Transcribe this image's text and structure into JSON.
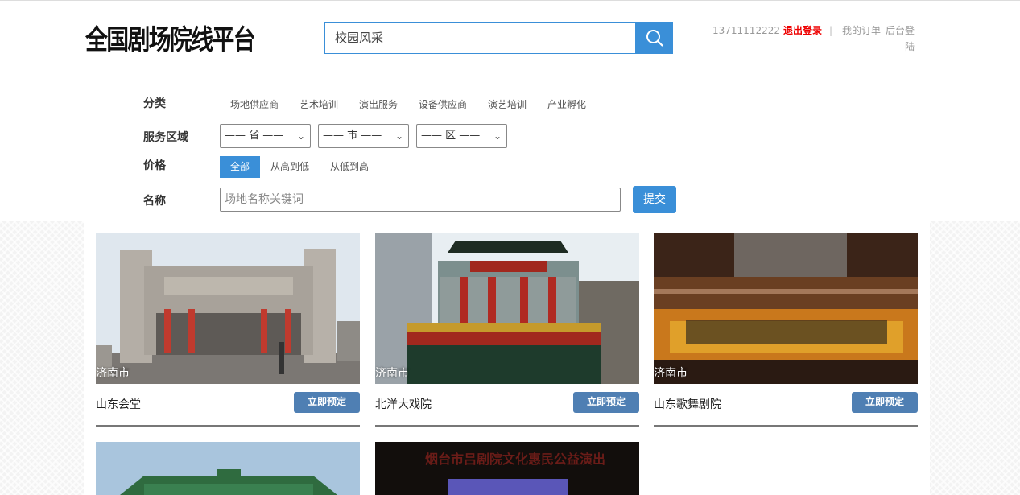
{
  "header": {
    "logo": "全国剧场院线平台",
    "search_value": "校园风采",
    "phone": "13711112222",
    "logout": "退出登录",
    "separator": "|",
    "my_orders": "我的订单",
    "admin_login": "后台登陆"
  },
  "filters": {
    "category_label": "分类",
    "categories": [
      "场地供应商",
      "艺术培训",
      "演出服务",
      "设备供应商",
      "演艺培训",
      "产业孵化"
    ],
    "region_label": "服务区域",
    "province": "—— 省 ——",
    "city": "—— 市 ——",
    "district": "—— 区 ——",
    "price_label": "价格",
    "price_options": [
      "全部",
      "从高到低",
      "从低到高"
    ],
    "name_label": "名称",
    "name_placeholder": "场地名称关键词",
    "submit": "提交"
  },
  "venues": [
    {
      "city": "济南市",
      "name": "山东会堂",
      "action": "立即预定"
    },
    {
      "city": "济南市",
      "name": "北洋大戏院",
      "action": "立即预定"
    },
    {
      "city": "济南市",
      "name": "山东歌舞剧院",
      "action": "立即预定"
    },
    {
      "city": "",
      "name": "",
      "action": ""
    },
    {
      "city": "",
      "name": "",
      "action": "",
      "banner": "烟台市吕剧院文化惠民公益演出"
    }
  ],
  "colors": {
    "accent": "#3a8fd8",
    "book_button": "#4f7fb3",
    "logout": "#ee0000"
  }
}
